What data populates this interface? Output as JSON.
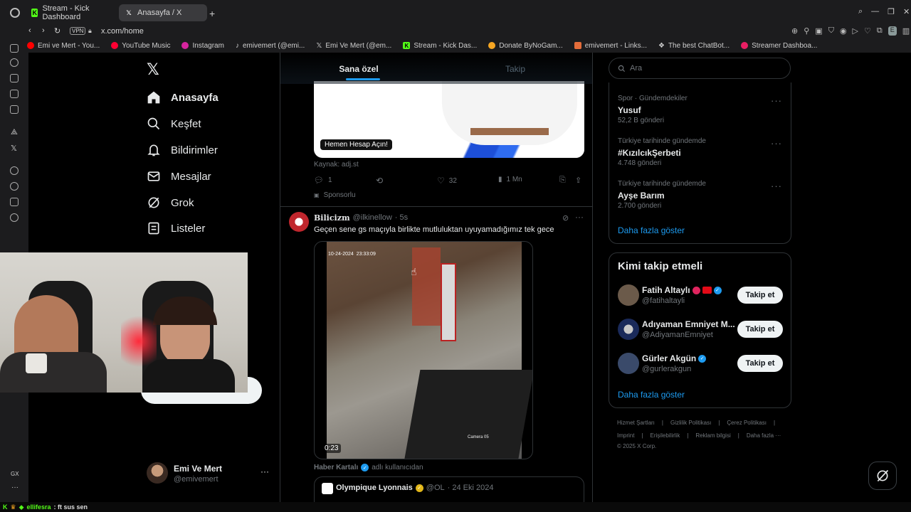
{
  "browser": {
    "tabs": [
      {
        "title": "Stream - Kick Dashboard",
        "active": false
      },
      {
        "title": "Anasayfa / X",
        "active": true
      }
    ],
    "vpn_label": "VPN",
    "url": "x.com/home",
    "bookmarks": [
      {
        "label": "Emi ve Mert - You...",
        "color": "#ff0000"
      },
      {
        "label": "YouTube Music",
        "color": "#ff0033"
      },
      {
        "label": "Instagram",
        "color": "#d6249f"
      },
      {
        "label": "emivemert (@emi...",
        "color": "#ffffff"
      },
      {
        "label": "Emi Ve Mert (@em...",
        "color": "#ffffff"
      },
      {
        "label": "Stream - Kick Das...",
        "color": "#53fc18"
      },
      {
        "label": "Donate ByNoGam...",
        "color": "#f5a623"
      },
      {
        "label": "emivemert - Links...",
        "color": "#e36c3a"
      },
      {
        "label": "The best ChatBot...",
        "color": "#ffffff"
      },
      {
        "label": "Streamer Dashboa...",
        "color": "#e91e63"
      }
    ]
  },
  "nav": {
    "items": [
      {
        "label": "Anasayfa",
        "icon": "home-icon"
      },
      {
        "label": "Keşfet",
        "icon": "search-icon"
      },
      {
        "label": "Bildirimler",
        "icon": "bell-icon"
      },
      {
        "label": "Mesajlar",
        "icon": "mail-icon"
      },
      {
        "label": "Grok",
        "icon": "grok-icon"
      },
      {
        "label": "Listeler",
        "icon": "list-icon"
      }
    ],
    "profile": {
      "name": "Emi Ve Mert",
      "handle": "@emivemert"
    }
  },
  "feed": {
    "tabs": [
      {
        "label": "Sana özel"
      },
      {
        "label": "Takip"
      }
    ],
    "ad": {
      "cta": "Hemen Hesap Açın!",
      "source": "Kaynak: adj.st",
      "replies": "1",
      "likes": "32",
      "views": "1 Mn",
      "sponsored": "Sponsorlu"
    },
    "post": {
      "author": "Bilicizm",
      "handle": "@ilkinellow",
      "time": "· 5s",
      "text": "Geçen sene gs maçıyla birlikte mutluluktan uyuyamadığımız tek gece",
      "video_timestamp": "10-24-2024  23:33:09",
      "camera_label": "Camera 05",
      "duration": "0:23",
      "attribution_user": "Haber Kartalı",
      "attribution_suffix": "adlı kullanıcıdan",
      "quoted_author": "Olympique Lyonnais",
      "quoted_handle": "@OL",
      "quoted_date": "· 24 Eki 2024"
    }
  },
  "right": {
    "search_placeholder": "Ara",
    "trends": [
      {
        "category": "Spor · Gündemdekiler",
        "name": "Yusuf",
        "count": "52,2 B gönderi"
      },
      {
        "category": "Türkiye tarihinde gündemde",
        "name": "#KızılcıkŞerbeti",
        "count": "4.748 gönderi"
      },
      {
        "category": "Türkiye tarihinde gündemde",
        "name": "Ayşe Barım",
        "count": "2.700 gönderi"
      }
    ],
    "show_more": "Daha fazla göster",
    "who_title": "Kimi takip etmeli",
    "who": [
      {
        "name": "Fatih Altaylı",
        "handle": "@fatihaltayli",
        "avatar_color": "#6b5a4a"
      },
      {
        "name": "Adıyaman Emniyet M...",
        "handle": "@AdiyamanEmniyet",
        "avatar_color": "#1a2a5a"
      },
      {
        "name": "Gürler Akgün",
        "handle": "@gurlerakgun",
        "avatar_color": "#3a4a6a"
      }
    ],
    "follow_label": "Takip et",
    "who_show_more": "Daha fazla göster",
    "footer_row1": [
      "Hizmet Şartları",
      "Gizlilik Politikası",
      "Çerez Politikası"
    ],
    "footer_row2": [
      "Imprint",
      "Erişilebilirlik",
      "Reklam bilgisi",
      "Daha fazla ···"
    ],
    "copyright": "© 2025 X Corp."
  },
  "chat": {
    "user": "ellifesra",
    "message": ": ft sus sen"
  },
  "colors": {
    "accent": "#1d9bf0",
    "background": "#000000",
    "border": "#2f3336"
  }
}
